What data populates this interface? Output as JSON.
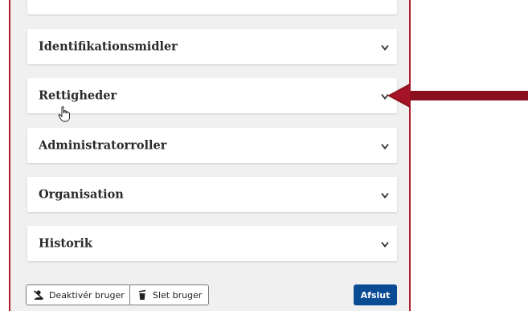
{
  "sections": [
    {
      "title": "Identifikationsmidler",
      "icon": "chevron-down-icon"
    },
    {
      "title": "Rettigheder",
      "icon": "chevron-down-icon"
    },
    {
      "title": "Administratorroller",
      "icon": "chevron-down-icon"
    },
    {
      "title": "Organisation",
      "icon": "chevron-down-icon"
    },
    {
      "title": "Historik",
      "icon": "chevron-down-icon"
    }
  ],
  "actions": {
    "deactivate_label": "Deaktivér bruger",
    "delete_label": "Slet bruger",
    "finish_label": "Afslut"
  },
  "colors": {
    "frame_border": "#b01e2e",
    "primary_button": "#0a4c94",
    "arrow": "#8b0f1c"
  }
}
